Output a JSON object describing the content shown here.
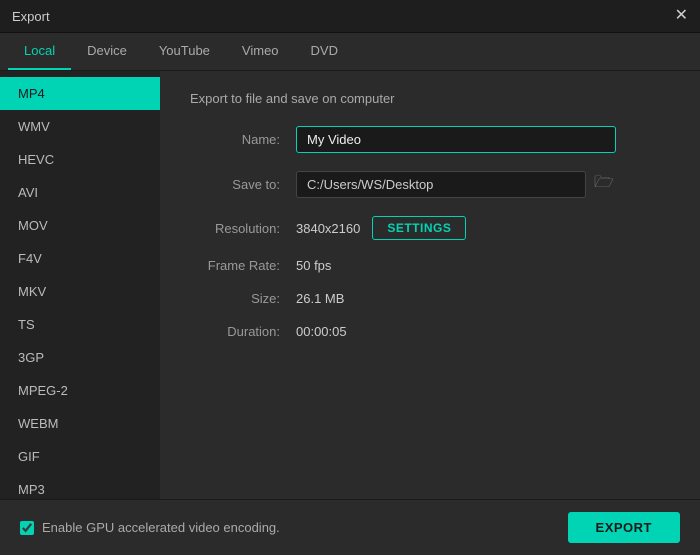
{
  "window": {
    "title": "Export",
    "close_icon": "✕"
  },
  "tabs": [
    {
      "id": "local",
      "label": "Local",
      "active": true
    },
    {
      "id": "device",
      "label": "Device",
      "active": false
    },
    {
      "id": "youtube",
      "label": "YouTube",
      "active": false
    },
    {
      "id": "vimeo",
      "label": "Vimeo",
      "active": false
    },
    {
      "id": "dvd",
      "label": "DVD",
      "active": false
    }
  ],
  "sidebar": {
    "items": [
      {
        "id": "mp4",
        "label": "MP4",
        "active": true
      },
      {
        "id": "wmv",
        "label": "WMV",
        "active": false
      },
      {
        "id": "hevc",
        "label": "HEVC",
        "active": false
      },
      {
        "id": "avi",
        "label": "AVI",
        "active": false
      },
      {
        "id": "mov",
        "label": "MOV",
        "active": false
      },
      {
        "id": "f4v",
        "label": "F4V",
        "active": false
      },
      {
        "id": "mkv",
        "label": "MKV",
        "active": false
      },
      {
        "id": "ts",
        "label": "TS",
        "active": false
      },
      {
        "id": "3gp",
        "label": "3GP",
        "active": false
      },
      {
        "id": "mpeg2",
        "label": "MPEG-2",
        "active": false
      },
      {
        "id": "webm",
        "label": "WEBM",
        "active": false
      },
      {
        "id": "gif",
        "label": "GIF",
        "active": false
      },
      {
        "id": "mp3",
        "label": "MP3",
        "active": false
      }
    ]
  },
  "main": {
    "section_title": "Export to file and save on computer",
    "name_label": "Name:",
    "name_value": "My Video",
    "save_to_label": "Save to:",
    "save_to_path": "C:/Users/WS/Desktop",
    "resolution_label": "Resolution:",
    "resolution_value": "3840x2160",
    "settings_button": "SETTINGS",
    "frame_rate_label": "Frame Rate:",
    "frame_rate_value": "50 fps",
    "size_label": "Size:",
    "size_value": "26.1 MB",
    "duration_label": "Duration:",
    "duration_value": "00:00:05"
  },
  "bottom": {
    "gpu_label": "Enable GPU accelerated video encoding.",
    "export_button": "EXPORT",
    "folder_icon": "🗁"
  }
}
